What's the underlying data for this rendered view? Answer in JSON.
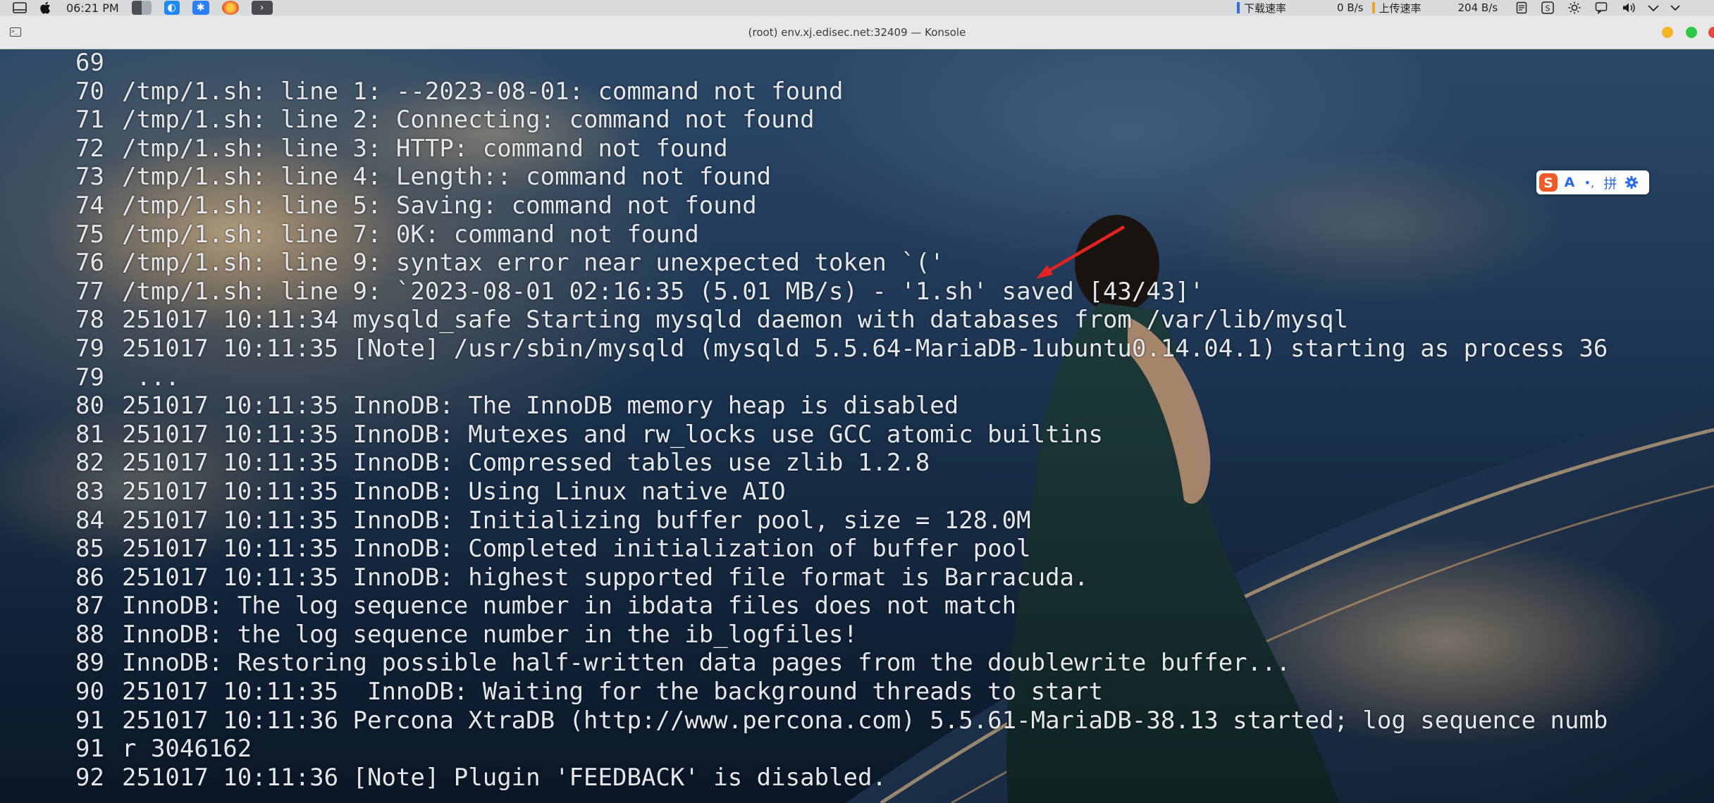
{
  "menubar": {
    "time": "06:21 PM",
    "download_label": "下载速率",
    "download_value": "0 B/s",
    "upload_label": "上传速率",
    "upload_value": "204 B/s"
  },
  "window": {
    "title": "(root) env.xj.edisec.net:32409 — Konsole",
    "buttons": {
      "minimize_color": "#f5b529",
      "maximize_color": "#2fc645",
      "close_color": "#e8453c"
    }
  },
  "terminal": {
    "lines": [
      {
        "num": "69",
        "text": ""
      },
      {
        "num": "70",
        "text": "/tmp/1.sh: line 1: --2023-08-01: command not found"
      },
      {
        "num": "71",
        "text": "/tmp/1.sh: line 2: Connecting: command not found"
      },
      {
        "num": "72",
        "text": "/tmp/1.sh: line 3: HTTP: command not found"
      },
      {
        "num": "73",
        "text": "/tmp/1.sh: line 4: Length:: command not found"
      },
      {
        "num": "74",
        "text": "/tmp/1.sh: line 5: Saving: command not found"
      },
      {
        "num": "75",
        "text": "/tmp/1.sh: line 7: 0K: command not found"
      },
      {
        "num": "76",
        "text": "/tmp/1.sh: line 9: syntax error near unexpected token `('"
      },
      {
        "num": "77",
        "text": "/tmp/1.sh: line 9: `2023-08-01 02:16:35 (5.01 MB/s) - '1.sh' saved [43/43]'"
      },
      {
        "num": "78",
        "text": "251017 10:11:34 mysqld_safe Starting mysqld daemon with databases from /var/lib/mysql"
      },
      {
        "num": "79",
        "text": "251017 10:11:35 [Note] /usr/sbin/mysqld (mysqld 5.5.64-MariaDB-1ubuntu0.14.04.1) starting as process 36"
      },
      {
        "num": "79",
        "text": " ..."
      },
      {
        "num": "80",
        "text": "251017 10:11:35 InnoDB: The InnoDB memory heap is disabled"
      },
      {
        "num": "81",
        "text": "251017 10:11:35 InnoDB: Mutexes and rw_locks use GCC atomic builtins"
      },
      {
        "num": "82",
        "text": "251017 10:11:35 InnoDB: Compressed tables use zlib 1.2.8"
      },
      {
        "num": "83",
        "text": "251017 10:11:35 InnoDB: Using Linux native AIO"
      },
      {
        "num": "84",
        "text": "251017 10:11:35 InnoDB: Initializing buffer pool, size = 128.0M"
      },
      {
        "num": "85",
        "text": "251017 10:11:35 InnoDB: Completed initialization of buffer pool"
      },
      {
        "num": "86",
        "text": "251017 10:11:35 InnoDB: highest supported file format is Barracuda."
      },
      {
        "num": "87",
        "text": "InnoDB: The log sequence number in ibdata files does not match"
      },
      {
        "num": "88",
        "text": "InnoDB: the log sequence number in the ib_logfiles!"
      },
      {
        "num": "89",
        "text": "InnoDB: Restoring possible half-written data pages from the doublewrite buffer..."
      },
      {
        "num": "90",
        "text": "251017 10:11:35  InnoDB: Waiting for the background threads to start"
      },
      {
        "num": "91",
        "text": "251017 10:11:36 Percona XtraDB (http://www.percona.com) 5.5.61-MariaDB-38.13 started; log sequence numb"
      },
      {
        "num": "91",
        "text": "r 3046162"
      },
      {
        "num": "92",
        "text": "251017 10:11:36 [Note] Plugin 'FEEDBACK' is disabled."
      }
    ]
  },
  "ime": {
    "logo_icon": "sogou-s-icon",
    "mode": "A",
    "punct": "•,",
    "pinyin": "拼",
    "settings_icon": "gear-icon"
  }
}
